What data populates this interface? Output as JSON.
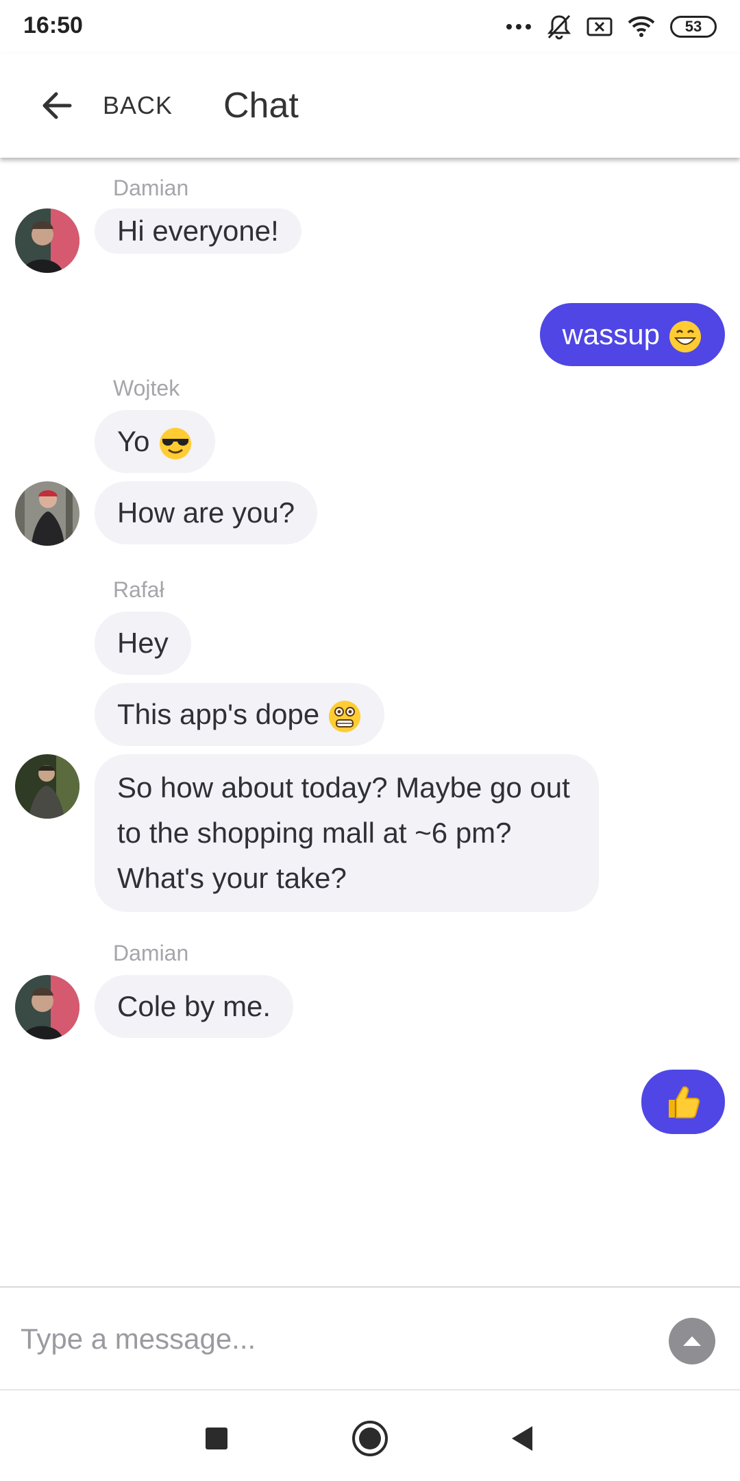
{
  "status_bar": {
    "time": "16:50",
    "battery": "53",
    "icons": [
      "more-dots-icon",
      "notifications-muted-icon",
      "no-sim-icon",
      "wifi-icon",
      "battery-icon"
    ]
  },
  "app_bar": {
    "back_label": "BACK",
    "title": "Chat"
  },
  "messages": [
    {
      "sender": "Damian",
      "text": "Hi everyone!",
      "mine": false
    },
    {
      "text": "wassup",
      "emoji": "grinning-face-icon",
      "mine": true
    },
    {
      "sender": "Wojtek",
      "text": "Yo",
      "emoji": "sunglasses-face-icon",
      "mine": false
    },
    {
      "text": "How are you?",
      "mine": false
    },
    {
      "sender": "Rafał",
      "text": "Hey",
      "mine": false
    },
    {
      "text": "This app's dope",
      "emoji": "flushed-grimace-face-icon",
      "mine": false
    },
    {
      "text": "So how about today? Maybe go out to the shopping mall at ~6 pm? What's your take?",
      "mine": false
    },
    {
      "sender": "Damian",
      "text": "Cole by me.",
      "mine": false
    },
    {
      "emoji": "thumbs-up-icon",
      "mine": true
    }
  ],
  "input": {
    "placeholder": "Type a message...",
    "value": ""
  },
  "nav": {
    "items": [
      "recents-square-icon",
      "home-circle-icon",
      "back-triangle-icon"
    ]
  },
  "colors": {
    "accent": "#4f46e5",
    "bubble_other": "#f2f2f7",
    "send_button": "#8e8e93"
  }
}
